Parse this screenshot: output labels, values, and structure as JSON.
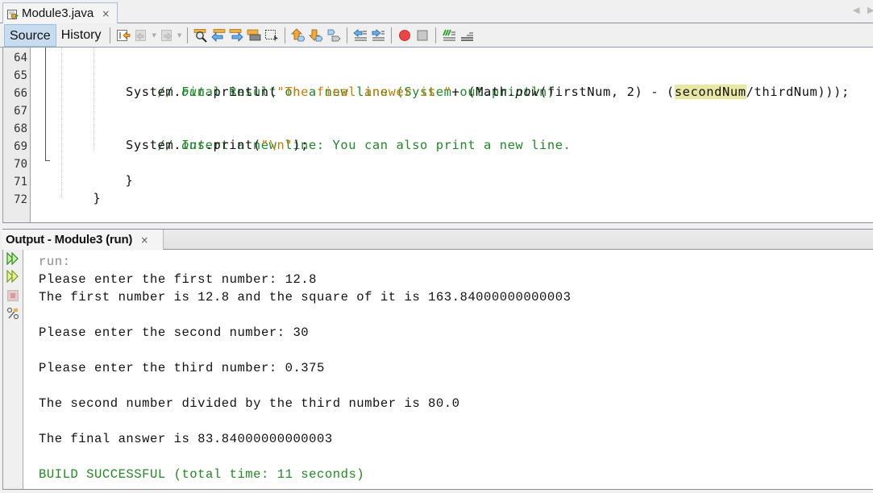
{
  "editor_tab": {
    "title": "Module3.java",
    "close": "×"
  },
  "toolbar": {
    "source_label": "Source",
    "history_label": "History"
  },
  "editor": {
    "line_numbers": [
      "64",
      "65",
      "66",
      "67",
      "68",
      "69",
      "70",
      "71",
      "72"
    ],
    "lines": {
      "l65_comment": "// Final Result on a new line (System.out.println)",
      "l66_a": "System.",
      "l66_out": "out",
      "l66_b": ".println(",
      "l66_str": "\"The final answer is \"",
      "l66_c": "+ (Math.",
      "l66_pow": "pow",
      "l66_d": "(firstNum, 2) - (",
      "l66_hl": "secondNum",
      "l66_e": "/thirdNum)));",
      "l68_comment": "// Insert a new line: You can also print a new line.",
      "l69_a": "System.",
      "l69_out": "out",
      "l69_b": ".print(",
      "l69_str": "\"\\n\"",
      "l69_c": ");",
      "l70": "}",
      "l71": "}"
    },
    "highlight_color": "#e8e8a0"
  },
  "output": {
    "tab_title": "Output - Module3 (run)",
    "close": "×",
    "lines": [
      "run:",
      "Please enter the first number: 12.8",
      "The first number is 12.8 and the square of it is 163.84000000000003",
      "",
      "Please enter the second number: 30",
      "",
      "Please enter the third number: 0.375",
      "",
      "The second number divided by the third number is 80.0",
      "",
      "The final answer is 83.84000000000003",
      "",
      "BUILD SUCCESSFUL (total time: 11 seconds)"
    ],
    "success_color": "#1f8a1f"
  }
}
